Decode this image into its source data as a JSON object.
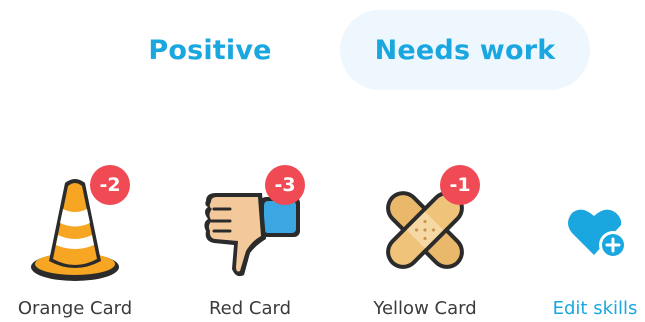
{
  "tabs": {
    "positive_label": "Positive",
    "needs_work_label": "Needs work",
    "active": "Needs work"
  },
  "skills": [
    {
      "label": "Orange Card",
      "points": "-2",
      "icon": "traffic-cone-icon"
    },
    {
      "label": "Red Card",
      "points": "-3",
      "icon": "thumbs-down-icon"
    },
    {
      "label": "Yellow Card",
      "points": "-1",
      "icon": "bandage-icon"
    }
  ],
  "edit_skills": {
    "label": "Edit skills",
    "icon": "heart-plus-icon"
  },
  "colors": {
    "accent": "#1aa7e0",
    "active_tab_bg": "#eef7fd",
    "badge": "#f04a55"
  }
}
